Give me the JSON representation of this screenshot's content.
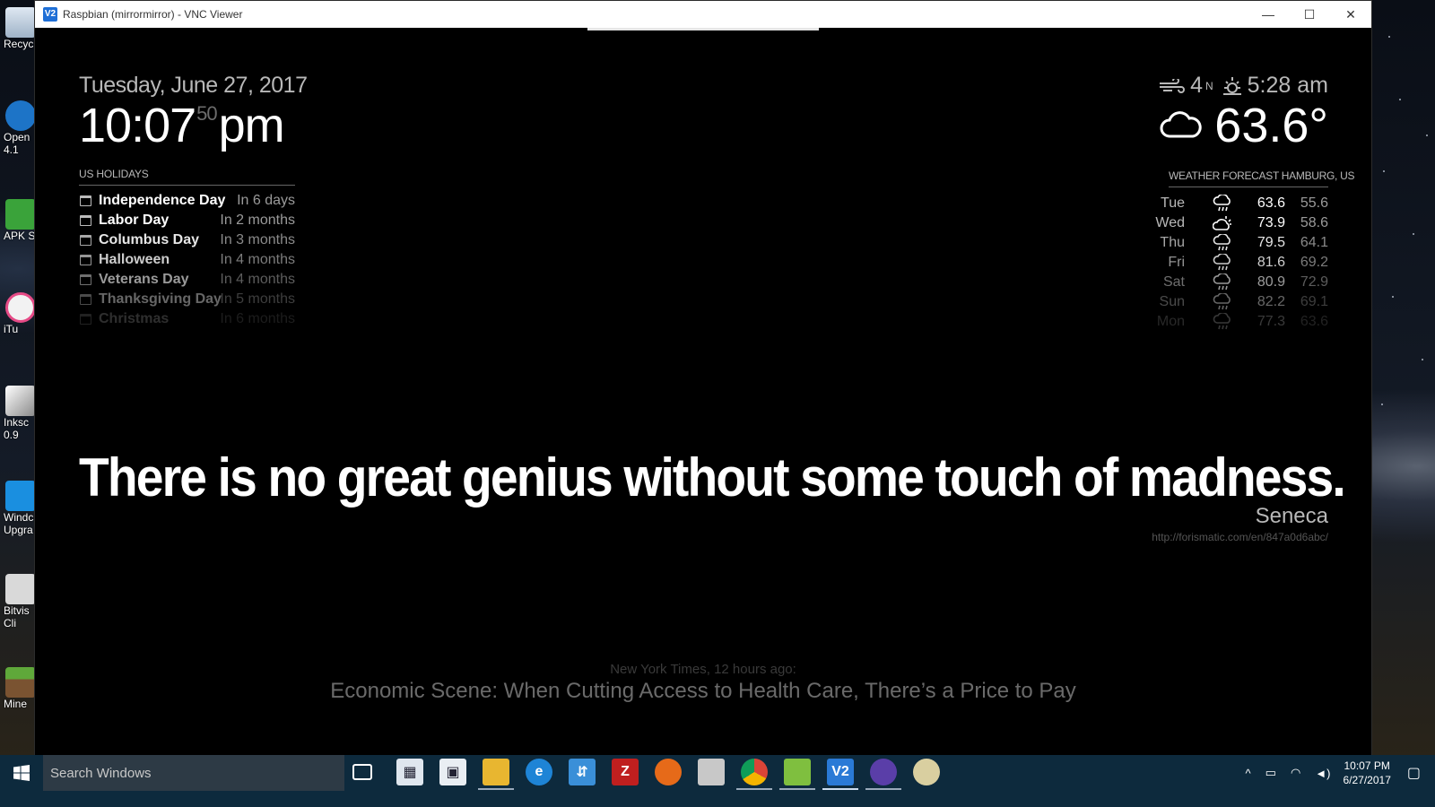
{
  "window": {
    "title": "Raspbian (mirrormirror) - VNC Viewer",
    "app_icon": "V2",
    "minimize": "—",
    "maximize": "☐",
    "close": "✕"
  },
  "desktop_icons": [
    {
      "label": "Recyc",
      "icon": "recycle-bin-icon"
    },
    {
      "label": "Open\n4.1",
      "icon": "openoffice-icon"
    },
    {
      "label": "APK S",
      "icon": "apk-icon"
    },
    {
      "label": "iTu",
      "icon": "itunes-icon"
    },
    {
      "label": "Inksc\n0.9",
      "icon": "inkscape-icon"
    },
    {
      "label": "Windc\nUpgra",
      "icon": "windows-upgrade-icon"
    },
    {
      "label": "Bitvis\nCli",
      "icon": "bitvise-icon"
    },
    {
      "label": "Mine",
      "icon": "minecraft-icon"
    }
  ],
  "clock_module": {
    "date": "Tuesday, June 27, 2017",
    "time": "10:07",
    "seconds": "50",
    "ampm": "pm"
  },
  "holidays": {
    "header": "US HOLIDAYS",
    "items": [
      {
        "name": "Independence Day",
        "when": "In 6 days"
      },
      {
        "name": "Labor Day",
        "when": "In 2 months"
      },
      {
        "name": "Columbus Day",
        "when": "In 3 months"
      },
      {
        "name": "Halloween",
        "when": "In 4 months"
      },
      {
        "name": "Veterans Day",
        "when": "In 4 months"
      },
      {
        "name": "Thanksgiving Day",
        "when": "In 5 months"
      },
      {
        "name": "Christmas",
        "when": "In 6 months"
      }
    ]
  },
  "current_weather": {
    "wind_speed": "4",
    "wind_dir": "N",
    "sunrise": "5:28 am",
    "temperature": "63.6°"
  },
  "forecast": {
    "header": "WEATHER FORECAST HAMBURG, US",
    "days": [
      {
        "day": "Tue",
        "icon": "rain-icon",
        "high": "63.6",
        "low": "55.6"
      },
      {
        "day": "Wed",
        "icon": "partly-cloudy-icon",
        "high": "73.9",
        "low": "58.6"
      },
      {
        "day": "Thu",
        "icon": "rain-icon",
        "high": "79.5",
        "low": "64.1"
      },
      {
        "day": "Fri",
        "icon": "rain-icon",
        "high": "81.6",
        "low": "69.2"
      },
      {
        "day": "Sat",
        "icon": "rain-icon",
        "high": "80.9",
        "low": "72.9"
      },
      {
        "day": "Sun",
        "icon": "rain-icon",
        "high": "82.2",
        "low": "69.1"
      },
      {
        "day": "Mon",
        "icon": "rain-icon",
        "high": "77.3",
        "low": "63.6"
      }
    ]
  },
  "quote": {
    "text": "There is no great genius without some touch of madness.",
    "author": "Seneca",
    "source": "http://forismatic.com/en/847a0d6abc/"
  },
  "news": {
    "source": "New York Times, 12 hours ago:",
    "headline": "Economic Scene: When Cutting Access to Health Care, There’s a Price to Pay"
  },
  "taskbar": {
    "search_placeholder": "Search Windows",
    "clock_time": "10:07 PM",
    "clock_date": "6/27/2017"
  }
}
